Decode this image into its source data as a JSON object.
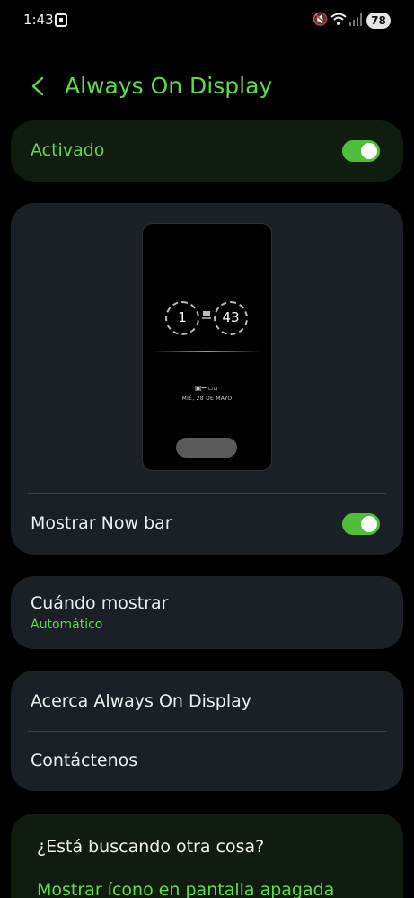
{
  "status_bar": {
    "time": "1:43",
    "battery": "78",
    "icons": [
      "screenshot-icon",
      "mute-icon",
      "wifi-icon",
      "signal-icon"
    ]
  },
  "header": {
    "title": "Always On Display"
  },
  "main_toggle": {
    "label": "Activado",
    "on": true
  },
  "preview": {
    "hour": "1",
    "minute": "43",
    "date": "MIÉ, 28 DE MAYO"
  },
  "now_bar": {
    "label": "Mostrar Now bar",
    "on": true
  },
  "when_to_show": {
    "label": "Cuándo mostrar",
    "value": "Automático"
  },
  "about": {
    "label": "Acerca Always On Display"
  },
  "contact": {
    "label": "Contáctenos"
  },
  "suggestion": {
    "title": "¿Está buscando otra cosa?",
    "link": "Mostrar ícono en pantalla apagada"
  },
  "colors": {
    "accent": "#5fdc43",
    "card": "#1b2027",
    "background": "#000000"
  }
}
